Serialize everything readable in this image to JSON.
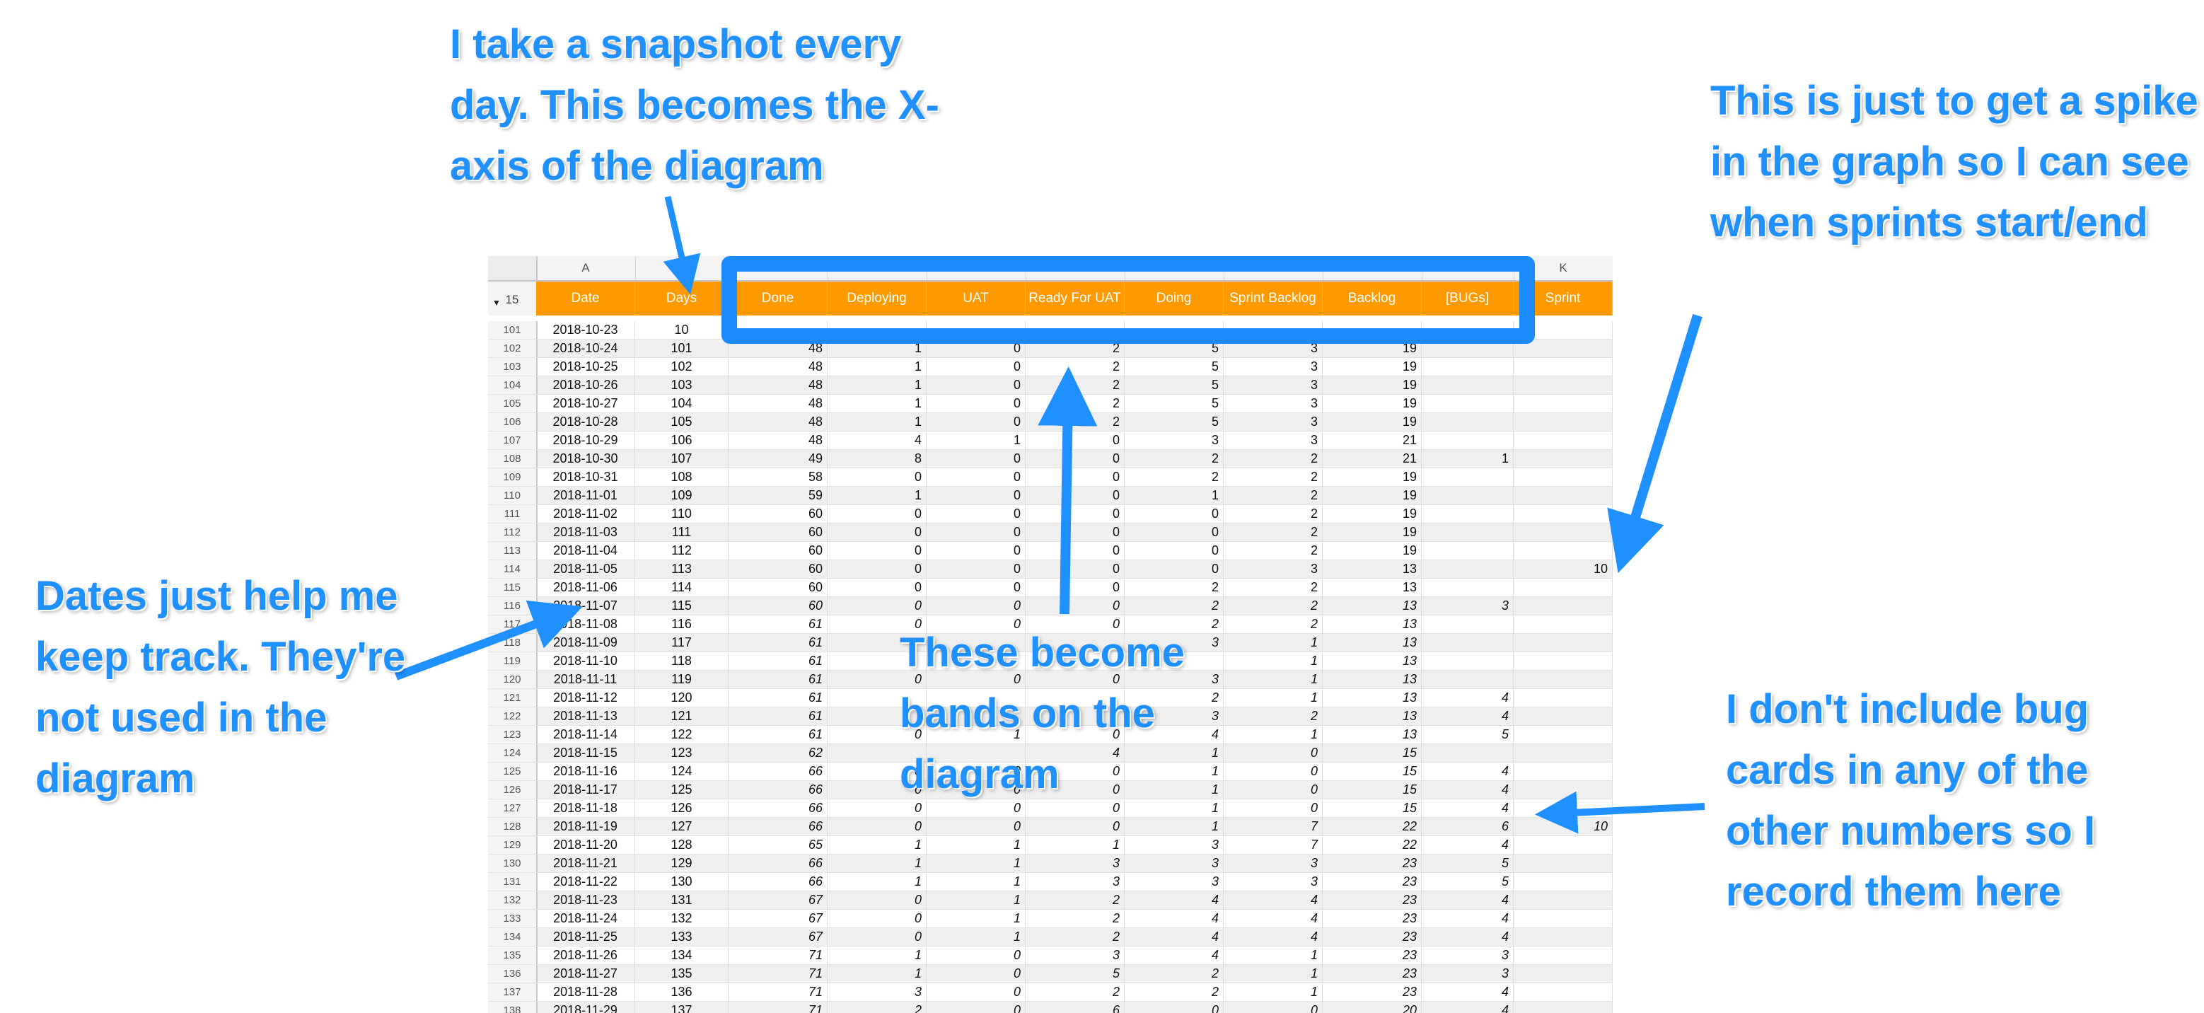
{
  "columns": [
    {
      "letter": "A",
      "header": "Date"
    },
    {
      "letter": "",
      "header": "Days"
    },
    {
      "letter": "",
      "header": "Done"
    },
    {
      "letter": "",
      "header": "Deploying"
    },
    {
      "letter": "",
      "header": "UAT"
    },
    {
      "letter": "",
      "header": "Ready For UAT"
    },
    {
      "letter": "",
      "header": "Doing"
    },
    {
      "letter": "",
      "header": "Sprint Backlog"
    },
    {
      "letter": "",
      "header": "Backlog"
    },
    {
      "letter": "",
      "header": "[BUGs]"
    },
    {
      "letter": "K",
      "header": "Sprint"
    }
  ],
  "header_row_number": "15",
  "rows": [
    [
      "101",
      "2018-10-23",
      "10",
      "",
      "",
      "",
      "",
      "",
      "",
      "",
      "",
      ""
    ],
    [
      "102",
      "2018-10-24",
      "101",
      "48",
      "1",
      "0",
      "2",
      "5",
      "3",
      "19",
      "",
      ""
    ],
    [
      "103",
      "2018-10-25",
      "102",
      "48",
      "1",
      "0",
      "2",
      "5",
      "3",
      "19",
      "",
      ""
    ],
    [
      "104",
      "2018-10-26",
      "103",
      "48",
      "1",
      "0",
      "2",
      "5",
      "3",
      "19",
      "",
      ""
    ],
    [
      "105",
      "2018-10-27",
      "104",
      "48",
      "1",
      "0",
      "2",
      "5",
      "3",
      "19",
      "",
      ""
    ],
    [
      "106",
      "2018-10-28",
      "105",
      "48",
      "1",
      "0",
      "2",
      "5",
      "3",
      "19",
      "",
      ""
    ],
    [
      "107",
      "2018-10-29",
      "106",
      "48",
      "4",
      "1",
      "0",
      "3",
      "3",
      "21",
      "",
      ""
    ],
    [
      "108",
      "2018-10-30",
      "107",
      "49",
      "8",
      "0",
      "0",
      "2",
      "2",
      "21",
      "1",
      ""
    ],
    [
      "109",
      "2018-10-31",
      "108",
      "58",
      "0",
      "0",
      "0",
      "2",
      "2",
      "19",
      "",
      ""
    ],
    [
      "110",
      "2018-11-01",
      "109",
      "59",
      "1",
      "0",
      "0",
      "1",
      "2",
      "19",
      "",
      ""
    ],
    [
      "111",
      "2018-11-02",
      "110",
      "60",
      "0",
      "0",
      "0",
      "0",
      "2",
      "19",
      "",
      ""
    ],
    [
      "112",
      "2018-11-03",
      "111",
      "60",
      "0",
      "0",
      "0",
      "0",
      "2",
      "19",
      "",
      ""
    ],
    [
      "113",
      "2018-11-04",
      "112",
      "60",
      "0",
      "0",
      "0",
      "0",
      "2",
      "19",
      "",
      ""
    ],
    [
      "114",
      "2018-11-05",
      "113",
      "60",
      "0",
      "0",
      "0",
      "0",
      "3",
      "13",
      "",
      "10"
    ],
    [
      "115",
      "2018-11-06",
      "114",
      "60",
      "0",
      "0",
      "0",
      "2",
      "2",
      "13",
      "",
      ""
    ],
    [
      "116",
      "2018-11-07",
      "115",
      "60",
      "0",
      "0",
      "0",
      "2",
      "2",
      "13",
      "3",
      ""
    ],
    [
      "117",
      "2018-11-08",
      "116",
      "61",
      "0",
      "0",
      "0",
      "2",
      "2",
      "13",
      "",
      ""
    ],
    [
      "118",
      "2018-11-09",
      "117",
      "61",
      "",
      "",
      "",
      "3",
      "1",
      "13",
      "",
      ""
    ],
    [
      "119",
      "2018-11-10",
      "118",
      "61",
      "",
      "",
      "",
      "",
      "1",
      "13",
      "",
      ""
    ],
    [
      "120",
      "2018-11-11",
      "119",
      "61",
      "0",
      "0",
      "0",
      "3",
      "1",
      "13",
      "",
      ""
    ],
    [
      "121",
      "2018-11-12",
      "120",
      "61",
      "",
      "",
      "",
      "2",
      "1",
      "13",
      "4",
      ""
    ],
    [
      "122",
      "2018-11-13",
      "121",
      "61",
      "",
      "",
      "",
      "3",
      "2",
      "13",
      "4",
      ""
    ],
    [
      "123",
      "2018-11-14",
      "122",
      "61",
      "0",
      "1",
      "0",
      "4",
      "1",
      "13",
      "5",
      ""
    ],
    [
      "124",
      "2018-11-15",
      "123",
      "62",
      "",
      "",
      "4",
      "1",
      "0",
      "15",
      "",
      ""
    ],
    [
      "125",
      "2018-11-16",
      "124",
      "66",
      "0",
      "0",
      "0",
      "1",
      "0",
      "15",
      "4",
      ""
    ],
    [
      "126",
      "2018-11-17",
      "125",
      "66",
      "0",
      "0",
      "0",
      "1",
      "0",
      "15",
      "4",
      ""
    ],
    [
      "127",
      "2018-11-18",
      "126",
      "66",
      "0",
      "0",
      "0",
      "1",
      "0",
      "15",
      "4",
      ""
    ],
    [
      "128",
      "2018-11-19",
      "127",
      "66",
      "0",
      "0",
      "0",
      "1",
      "7",
      "22",
      "6",
      "10"
    ],
    [
      "129",
      "2018-11-20",
      "128",
      "65",
      "1",
      "1",
      "1",
      "3",
      "7",
      "22",
      "4",
      ""
    ],
    [
      "130",
      "2018-11-21",
      "129",
      "66",
      "1",
      "1",
      "3",
      "3",
      "3",
      "23",
      "5",
      ""
    ],
    [
      "131",
      "2018-11-22",
      "130",
      "66",
      "1",
      "1",
      "3",
      "3",
      "3",
      "23",
      "5",
      ""
    ],
    [
      "132",
      "2018-11-23",
      "131",
      "67",
      "0",
      "1",
      "2",
      "4",
      "4",
      "23",
      "4",
      ""
    ],
    [
      "133",
      "2018-11-24",
      "132",
      "67",
      "0",
      "1",
      "2",
      "4",
      "4",
      "23",
      "4",
      ""
    ],
    [
      "134",
      "2018-11-25",
      "133",
      "67",
      "0",
      "1",
      "2",
      "4",
      "4",
      "23",
      "4",
      ""
    ],
    [
      "135",
      "2018-11-26",
      "134",
      "71",
      "1",
      "0",
      "3",
      "4",
      "1",
      "23",
      "3",
      ""
    ],
    [
      "136",
      "2018-11-27",
      "135",
      "71",
      "1",
      "0",
      "5",
      "2",
      "1",
      "23",
      "3",
      ""
    ],
    [
      "137",
      "2018-11-28",
      "136",
      "71",
      "3",
      "0",
      "2",
      "2",
      "1",
      "23",
      "4",
      ""
    ],
    [
      "138",
      "2018-11-29",
      "137",
      "71",
      "2",
      "0",
      "6",
      "0",
      "0",
      "20",
      "4",
      ""
    ]
  ],
  "annotations": {
    "snapshot": "I take a snapshot every day. This becomes the X-axis of the diagram",
    "spike": "This is just to get a spike in the graph so I can see when sprints start/end",
    "dates": "Dates just help me keep track. They're not used in the diagram",
    "bands": "These become bands on the diagram",
    "bugs": "I don't include bug cards in any of the other numbers so I record them here"
  },
  "colors": {
    "header": "#ff9900",
    "annotation": "#1e90ff",
    "highlight": "#1c8aff"
  }
}
